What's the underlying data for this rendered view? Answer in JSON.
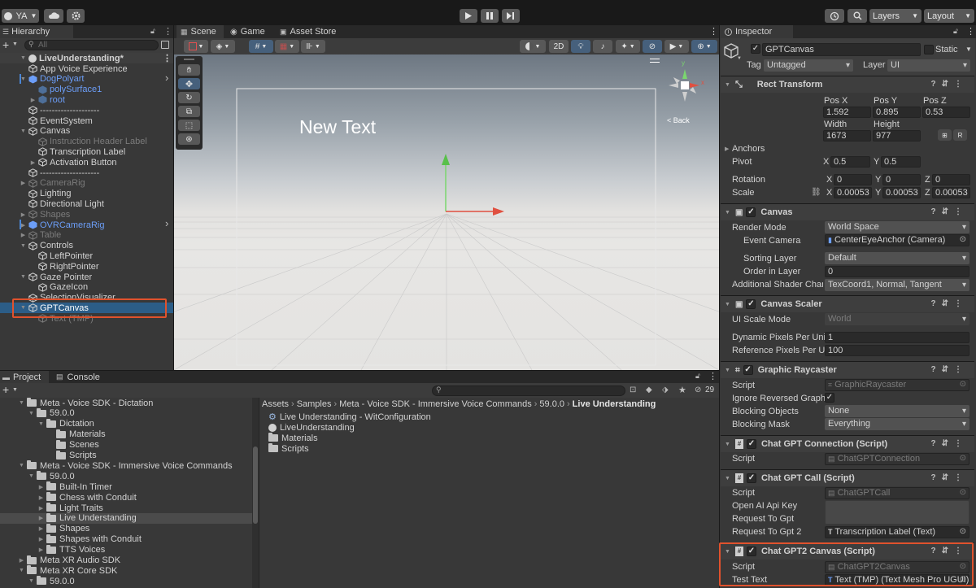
{
  "toolbar": {
    "account_label": "YA",
    "layers_label": "Layers",
    "layout_label": "Layout"
  },
  "hierarchy": {
    "tab_label": "Hierarchy",
    "search_placeholder": "All",
    "scene_name": "LiveUnderstanding*",
    "items": [
      {
        "label": "App Voice Experience"
      },
      {
        "label": "DogPolyart"
      },
      {
        "label": "polySurface1"
      },
      {
        "label": "root"
      },
      {
        "label": "--------------------"
      },
      {
        "label": "EventSystem"
      },
      {
        "label": "Canvas"
      },
      {
        "label": "Instruction Header Label"
      },
      {
        "label": "Transcription Label"
      },
      {
        "label": "Activation Button"
      },
      {
        "label": "--------------------"
      },
      {
        "label": "CameraRig"
      },
      {
        "label": "Lighting"
      },
      {
        "label": "Directional Light"
      },
      {
        "label": "Shapes"
      },
      {
        "label": "OVRCameraRig"
      },
      {
        "label": "Table"
      },
      {
        "label": "Controls"
      },
      {
        "label": "LeftPointer"
      },
      {
        "label": "RightPointer"
      },
      {
        "label": "Gaze Pointer"
      },
      {
        "label": "GazeIcon"
      },
      {
        "label": "SelectionVisualizer"
      },
      {
        "label": "GPTCanvas"
      },
      {
        "label": "Text (TMP)"
      }
    ]
  },
  "scene": {
    "tabs": [
      "Scene",
      "Game",
      "Asset Store"
    ],
    "mode_2d": "2D",
    "canvas_text": "New Text",
    "back_label": "< Back",
    "gizmo_x": "x",
    "gizmo_y": "y"
  },
  "inspector": {
    "tab_label": "Inspector",
    "object_name": "GPTCanvas",
    "static_label": "Static",
    "tag_label": "Tag",
    "tag_value": "Untagged",
    "layer_label": "Layer",
    "layer_value": "UI",
    "rect_transform": {
      "title": "Rect Transform",
      "pos_x_label": "Pos X",
      "pos_x": "1.592",
      "pos_y_label": "Pos Y",
      "pos_y": "0.895",
      "pos_z_label": "Pos Z",
      "pos_z": "0.53",
      "width_label": "Width",
      "width": "1673",
      "height_label": "Height",
      "height": "977",
      "r_label": "R",
      "anchors_label": "Anchors",
      "pivot_label": "Pivot",
      "pivot_x": "0.5",
      "pivot_y": "0.5",
      "rotation_label": "Rotation",
      "rot_x": "0",
      "rot_y": "0",
      "rot_z": "0",
      "scale_label": "Scale",
      "scale_x": "0.00053",
      "scale_y": "0.00053",
      "scale_z": "0.00053",
      "x": "X",
      "y": "Y",
      "z": "Z"
    },
    "canvas": {
      "title": "Canvas",
      "render_mode_label": "Render Mode",
      "render_mode": "World Space",
      "event_camera_label": "Event Camera",
      "event_camera": "CenterEyeAnchor (Camera)",
      "sorting_layer_label": "Sorting Layer",
      "sorting_layer": "Default",
      "order_label": "Order in Layer",
      "order": "0",
      "shader_label": "Additional Shader Channe",
      "shader": "TexCoord1, Normal, Tangent"
    },
    "canvas_scaler": {
      "title": "Canvas Scaler",
      "ui_scale_label": "UI Scale Mode",
      "ui_scale": "World",
      "dpu_label": "Dynamic Pixels Per Unit",
      "dpu": "1",
      "rpu_label": "Reference Pixels Per Unit",
      "rpu": "100"
    },
    "graphic_raycaster": {
      "title": "Graphic Raycaster",
      "script_label": "Script",
      "script": "GraphicRaycaster",
      "ignore_label": "Ignore Reversed Graphics",
      "blocking_objects_label": "Blocking Objects",
      "blocking_objects": "None",
      "blocking_mask_label": "Blocking Mask",
      "blocking_mask": "Everything"
    },
    "chat_gpt_connection": {
      "title": "Chat GPT Connection (Script)",
      "script_label": "Script",
      "script": "ChatGPTConnection"
    },
    "chat_gpt_call": {
      "title": "Chat GPT Call (Script)",
      "script_label": "Script",
      "script": "ChatGPTCall",
      "api_key_label": "Open AI Api Key",
      "request_label": "Request To Gpt",
      "request2_label": "Request To Gpt 2",
      "request2": "Transcription Label (Text)"
    },
    "chat_gpt2_canvas": {
      "title": "Chat GPT2 Canvas (Script)",
      "script_label": "Script",
      "script": "ChatGPT2Canvas",
      "test_text_label": "Test Text",
      "test_text": "Text (TMP) (Text Mesh Pro UGUI)"
    }
  },
  "project": {
    "tabs": [
      "Project",
      "Console"
    ],
    "eye_count": "29",
    "breadcrumb": [
      "Assets",
      "Samples",
      "Meta - Voice SDK - Immersive Voice Commands",
      "59.0.0",
      "Live Understanding"
    ],
    "tree": [
      {
        "label": "Meta - Voice SDK - Dictation"
      },
      {
        "label": "59.0.0"
      },
      {
        "label": "Dictation"
      },
      {
        "label": "Materials"
      },
      {
        "label": "Scenes"
      },
      {
        "label": "Scripts"
      },
      {
        "label": "Meta - Voice SDK - Immersive Voice Commands"
      },
      {
        "label": "59.0.0"
      },
      {
        "label": "Built-In Timer"
      },
      {
        "label": "Chess with Conduit"
      },
      {
        "label": "Light Traits"
      },
      {
        "label": "Live Understanding"
      },
      {
        "label": "Shapes"
      },
      {
        "label": "Shapes with Conduit"
      },
      {
        "label": "TTS Voices"
      },
      {
        "label": "Meta XR Audio SDK"
      },
      {
        "label": "Meta XR Core SDK"
      },
      {
        "label": "59.0.0"
      }
    ],
    "files": [
      {
        "label": "Live Understanding - WitConfiguration"
      },
      {
        "label": "LiveUnderstanding"
      },
      {
        "label": "Materials"
      },
      {
        "label": "Scripts"
      }
    ]
  },
  "colors": {
    "highlight": "#e0522d",
    "selection": "#2c5d87",
    "accent_blue": "#6c9ef8"
  }
}
